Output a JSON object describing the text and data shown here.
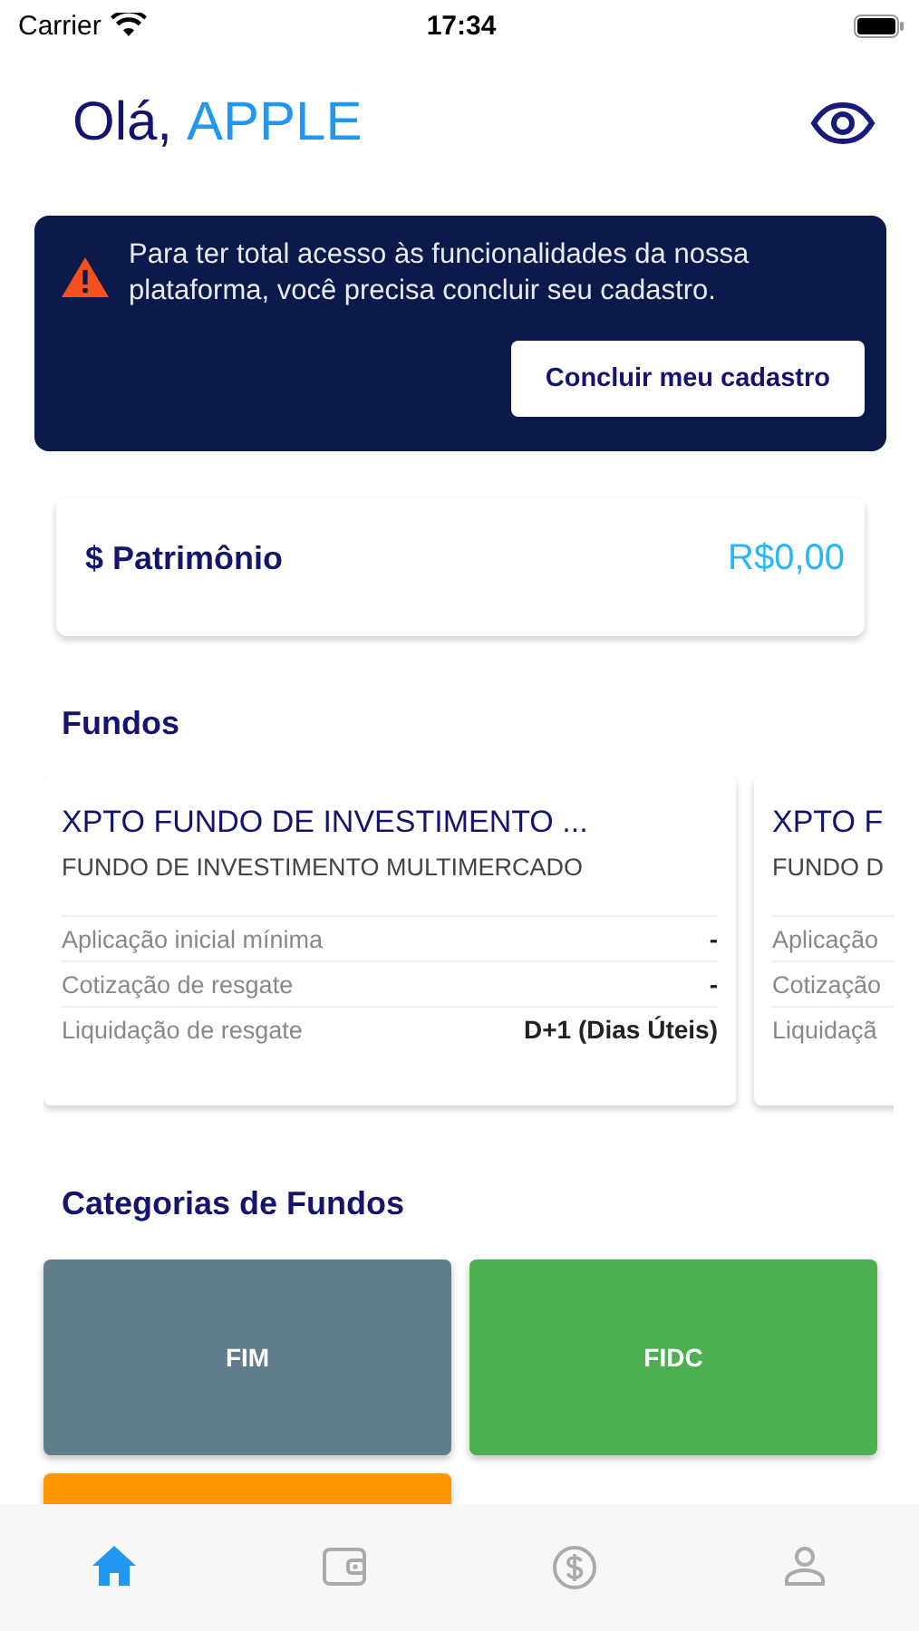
{
  "status_bar": {
    "carrier": "Carrier",
    "time": "17:34"
  },
  "greeting": {
    "hello": "Olá,",
    "name": "APPLE"
  },
  "banner": {
    "message": "Para ter total acesso às funcionalidades da nossa plataforma, você precisa concluir seu cadastro.",
    "button": "Concluir meu cadastro"
  },
  "patrimonio": {
    "symbol": "$",
    "label": "Patrimônio",
    "value": "R$0,00"
  },
  "funds_title": "Fundos",
  "funds": [
    {
      "name": "XPTO FUNDO DE INVESTIMENTO ...",
      "type": "FUNDO DE INVESTIMENTO MULTIMERCADO",
      "rows": [
        {
          "label": "Aplicação inicial mínima",
          "value": "-"
        },
        {
          "label": "Cotização de resgate",
          "value": "-"
        },
        {
          "label": "Liquidação de resgate",
          "value": "D+1 (Dias Úteis)"
        }
      ]
    },
    {
      "name": "XPTO F",
      "type": "FUNDO D",
      "rows": [
        {
          "label": "Aplicação"
        },
        {
          "label": "Cotização"
        },
        {
          "label": "Liquidaçã"
        }
      ]
    }
  ],
  "categories_title": "Categorias de Fundos",
  "categories": [
    {
      "label": "FIM",
      "color": "#607d8b"
    },
    {
      "label": "FIDC",
      "color": "#4caf50"
    },
    {
      "color": "#ff9800"
    }
  ],
  "tabs": [
    {
      "kind": "home",
      "selected": true
    },
    {
      "kind": "wallet",
      "selected": false
    },
    {
      "kind": "money",
      "selected": false
    },
    {
      "kind": "profile",
      "selected": false
    }
  ]
}
